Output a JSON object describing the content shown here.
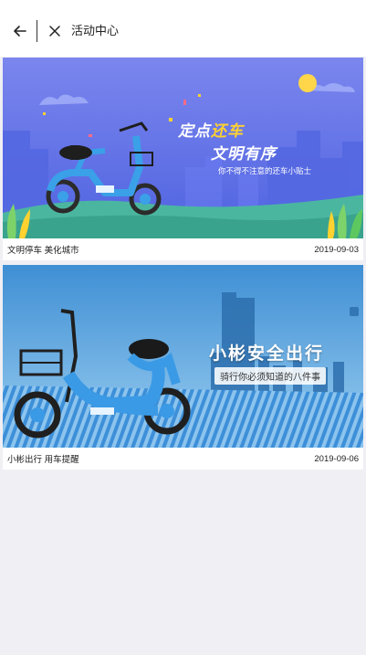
{
  "header": {
    "title": "活动中心",
    "back_icon": "arrow-left-icon",
    "close_icon": "close-icon"
  },
  "activities": [
    {
      "banner": {
        "headline_part1": "定点",
        "headline_highlight": "还车",
        "headline_line2": "文明有序",
        "subtitle": "你不得不注意的还车小贴士",
        "colors": {
          "sky": "#5c6fe6",
          "highlight": "#ffd230",
          "bike": "#3aa0e8"
        }
      },
      "caption": "文明停车 美化城市",
      "date": "2019-09-03"
    },
    {
      "banner": {
        "headline": "小彬安全出行",
        "subtitle": "骑行你必须知道的八件事",
        "colors": {
          "sky": "#5aa4dc",
          "bike": "#3a9ae6"
        }
      },
      "caption": "小彬出行 用车提醒",
      "date": "2019-09-06"
    }
  ]
}
